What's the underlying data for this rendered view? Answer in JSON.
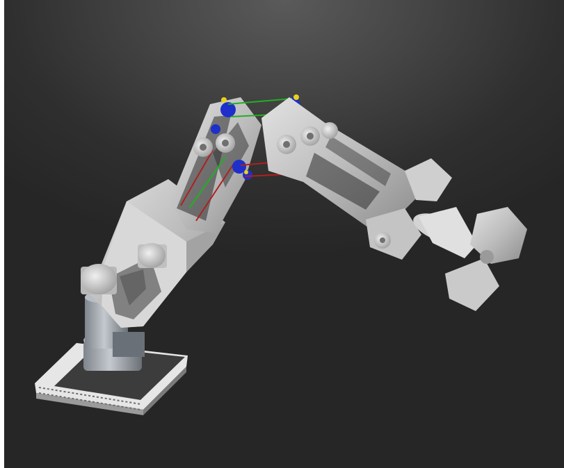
{
  "scene": {
    "subject": "robot-arm-model",
    "background_top": "#5a5a5a",
    "background_bottom": "#262626",
    "part_color": "#c9c9c9",
    "part_shadow": "#8a8a8a",
    "bearing_color": "#1f2fc9",
    "marker_color": "#e8d21a",
    "link_red": "#b02020",
    "link_green": "#21b021"
  }
}
